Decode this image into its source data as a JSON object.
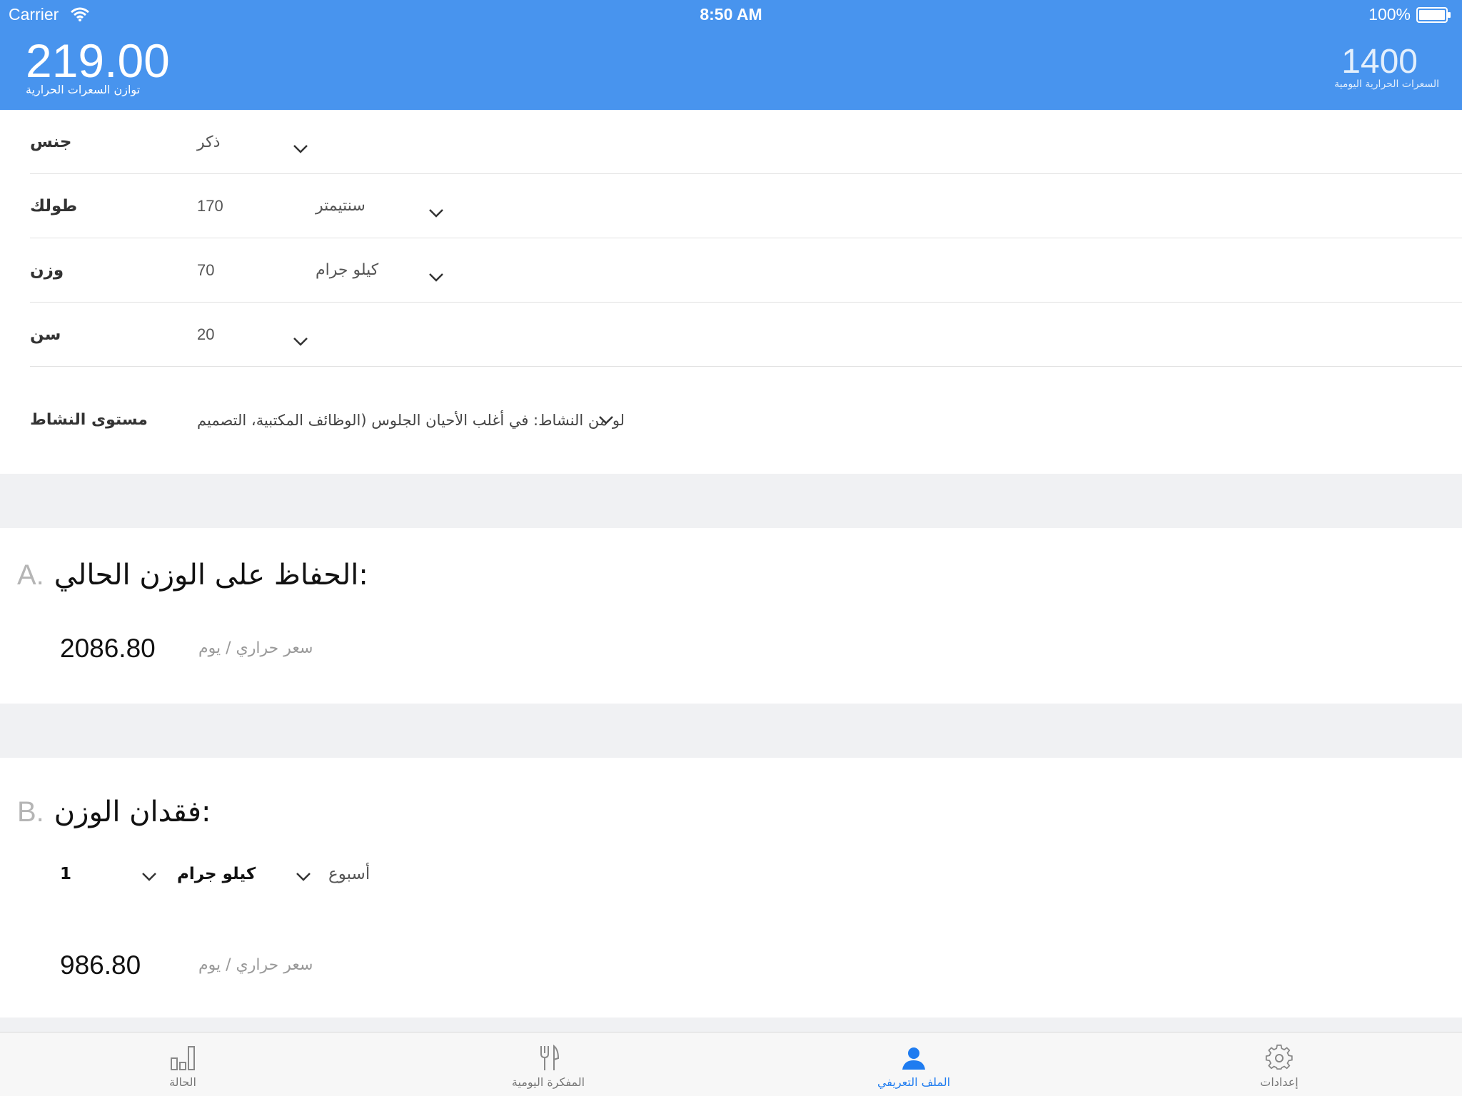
{
  "status_bar": {
    "carrier": "Carrier",
    "time": "8:50 AM",
    "battery": "100%"
  },
  "header": {
    "balance_value": "219.00",
    "balance_label": "توازن السعرات الحرارية",
    "daily_value": "1400",
    "daily_label": "السعرات الحرارية اليومية",
    "background_color": "#4894ee"
  },
  "profile": {
    "gender": {
      "label": "جنس",
      "value": "ذكر"
    },
    "height": {
      "label": "طولك",
      "value": "170",
      "unit": "سنتيمتر"
    },
    "weight": {
      "label": "وزن",
      "value": "70",
      "unit": "كيلو جرام"
    },
    "age": {
      "label": "سن",
      "value": "20"
    },
    "activity": {
      "label": "مستوى النشاط",
      "value": "لو من النشاط: في أغلب الأحيان الجلوس (الوظائف المكتبية، التصميم"
    }
  },
  "maintain": {
    "letter": "A.",
    "title": "الحفاظ على الوزن الحالي:",
    "value": "2086.80",
    "unit": "سعر حراري / يوم"
  },
  "lose": {
    "letter": "B.",
    "title": "فقدان الوزن:",
    "amount": "1",
    "amount_unit": "كيلو جرام",
    "period": "أسبوع",
    "value": "986.80",
    "unit": "سعر حراري / يوم"
  },
  "tabs": [
    {
      "label": "الحالة",
      "icon": "bar-chart-icon",
      "active": false
    },
    {
      "label": "المفكرة اليومية",
      "icon": "fork-knife-icon",
      "active": false
    },
    {
      "label": "الملف التعريفي",
      "icon": "person-icon",
      "active": true
    },
    {
      "label": "إعدادات",
      "icon": "gear-icon",
      "active": false
    }
  ],
  "accent_color": "#1f7cf0"
}
